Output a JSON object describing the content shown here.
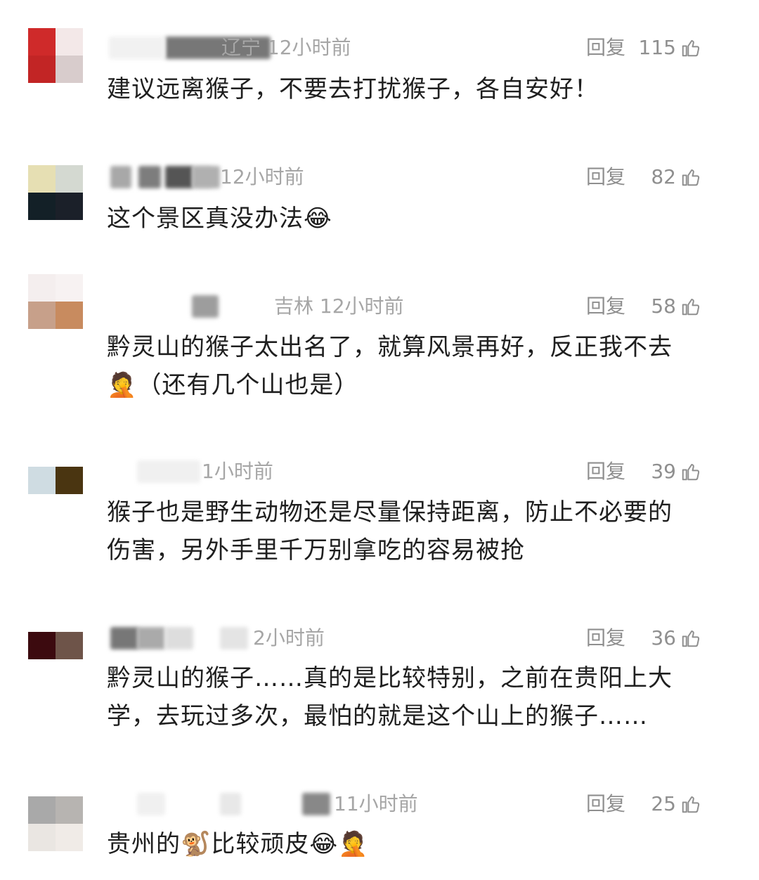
{
  "comments": [
    {
      "location_time": "辽宁 12小时前",
      "reply": "回复",
      "likes": "115",
      "text": "建议远离猴子，不要去打扰猴子，各自安好！",
      "avatar_colors": [
        "#cf2a2a",
        "#f3e8e8",
        "#c22525",
        "#d8cccc"
      ]
    },
    {
      "location_time": "12小时前",
      "reply": "回复",
      "likes": "82",
      "text": "这个景区真没办法",
      "emoji": "😂",
      "avatar_colors": [
        "#e6dfb3",
        "#d4d9d1",
        "#132027",
        "#1b2029"
      ]
    },
    {
      "location_time": "吉林 12小时前",
      "reply": "回复",
      "likes": "58",
      "text_lines": [
        "黔灵山的猴子太出名了，就算风景再好，反正我不去",
        "（还有几个山也是）"
      ],
      "emoji": "🤦",
      "avatar_colors": [
        "#f4eeee",
        "#f7f2f2",
        "#c7a08a",
        "#c88b5f"
      ]
    },
    {
      "location_time": "1小时前",
      "reply": "回复",
      "likes": "39",
      "text_lines": [
        "猴子也是野生动物还是尽量保持距离，防止不必要的",
        "伤害，另外手里千万别拿吃的容易被抢"
      ],
      "avatar_colors": [
        "#ffffff",
        "#ffffff",
        "#cfdce2",
        "#4a3511"
      ]
    },
    {
      "location_time": "2小时前",
      "reply": "回复",
      "likes": "36",
      "text_lines": [
        "黔灵山的猴子……真的是比较特别，之前在贵阳上大",
        "学，去玩过多次，最怕的就是这个山上的猴子……"
      ],
      "avatar_colors": [
        "#ffffff",
        "#ffffff",
        "#3c0a0f",
        "#6e5449"
      ]
    },
    {
      "location_time": "11小时前",
      "reply": "回复",
      "likes": "25",
      "text_prefix": "贵州的",
      "monkey_emoji": "🐒",
      "text_suffix": "比较顽皮",
      "emoji_end": "😂🤦",
      "avatar_colors": [
        "#a9a9a9",
        "#b7b4b1",
        "#eae6e2",
        "#f0ebe7"
      ]
    }
  ],
  "icons": {
    "like": "thumbs-up-icon"
  }
}
